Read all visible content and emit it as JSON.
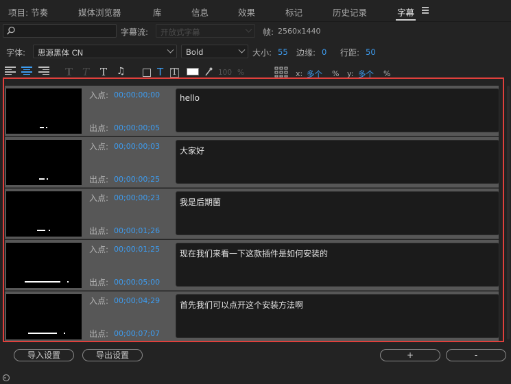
{
  "tabs": [
    {
      "label": "项目: 节奏"
    },
    {
      "label": "媒体浏览器"
    },
    {
      "label": "库"
    },
    {
      "label": "信息"
    },
    {
      "label": "效果"
    },
    {
      "label": "标记"
    },
    {
      "label": "历史记录"
    },
    {
      "label": "字幕",
      "active": true
    }
  ],
  "toolbar": {
    "search_placeholder": "",
    "stream_label": "字幕流:",
    "stream_value": "开放式字幕",
    "frame_label": "帧:",
    "frame_value": "2560x1440",
    "font_label": "字体:",
    "font_family": "思源黑体 CN",
    "font_style": "Bold",
    "size_label": "大小:",
    "size_value": "55",
    "margin_label": "边缘:",
    "margin_value": "0",
    "line_spacing_label": "行距:",
    "line_spacing_value": "50",
    "opacity_value": "100",
    "pct": "%",
    "x_label": "x:",
    "x_value": "多个",
    "y_label": "y:",
    "y_value": "多个"
  },
  "captions": {
    "in_label": "入点:",
    "out_label": "出点:",
    "items": [
      {
        "in": "00;00;00;00",
        "out": "00;00;00;05",
        "text": "hello"
      },
      {
        "in": "00;00;00;03",
        "out": "00;00;00;25",
        "text": "大家好"
      },
      {
        "in": "00;00;00;23",
        "out": "00;00;01;26",
        "text": "我是后期菌"
      },
      {
        "in": "00;00;01;25",
        "out": "00;00;05;00",
        "text": "现在我们来看一下这款插件是如何安装的"
      },
      {
        "in": "00;00;04;29",
        "out": "00;00;07;07",
        "text": "首先我们可以点开这个安装方法啊"
      }
    ]
  },
  "footer": {
    "import_label": "导入设置",
    "export_label": "导出设置",
    "add_label": "+",
    "remove_label": "-"
  },
  "colors": {
    "accent": "#3d9cf0",
    "highlight_frame": "#e0403c",
    "panel_bg": "#232323",
    "row_bg": "#575757"
  }
}
